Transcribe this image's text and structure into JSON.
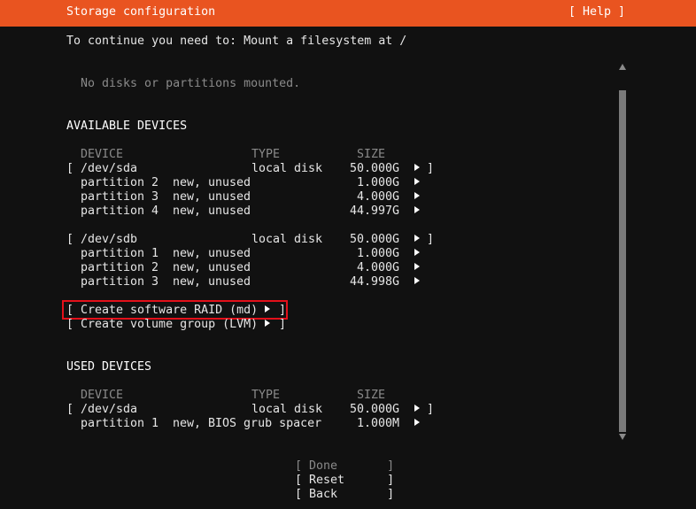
{
  "header": {
    "title": "Storage configuration",
    "help": "[ Help ]"
  },
  "instruction": "To continue you need to: Mount a filesystem at /",
  "mounted_empty": "No disks or partitions mounted.",
  "available": {
    "heading": "AVAILABLE DEVICES",
    "columns": {
      "device": "DEVICE",
      "type": "TYPE",
      "size": "SIZE"
    },
    "rows": [
      {
        "bracket_open": "[",
        "device": "/dev/sda",
        "type": "local disk",
        "size": "50.000G",
        "bracket_close": "]"
      },
      {
        "device": "partition 2",
        "type": "new, unused",
        "size": "1.000G"
      },
      {
        "device": "partition 3",
        "type": "new, unused",
        "size": "4.000G"
      },
      {
        "device": "partition 4",
        "type": "new, unused",
        "size": "44.997G"
      },
      {
        "bracket_open": "[",
        "device": "/dev/sdb",
        "type": "local disk",
        "size": "50.000G",
        "bracket_close": "]"
      },
      {
        "device": "partition 1",
        "type": "new, unused",
        "size": "1.000G"
      },
      {
        "device": "partition 2",
        "type": "new, unused",
        "size": "4.000G"
      },
      {
        "device": "partition 3",
        "type": "new, unused",
        "size": "44.998G"
      }
    ],
    "create_raid": {
      "open": "[",
      "label": "Create software RAID (md)",
      "close": "]"
    },
    "create_vg": {
      "open": "[",
      "label": "Create volume group (LVM)",
      "close": "]"
    }
  },
  "used": {
    "heading": "USED DEVICES",
    "columns": {
      "device": "DEVICE",
      "type": "TYPE",
      "size": "SIZE"
    },
    "rows": [
      {
        "bracket_open": "[",
        "device": "/dev/sda",
        "type": "local disk",
        "size": "50.000G",
        "bracket_close": "]"
      },
      {
        "device": "partition 1",
        "type": "new, BIOS grub spacer",
        "size": "1.000M"
      }
    ]
  },
  "buttons": {
    "done": "[ Done       ]",
    "reset": "[ Reset      ]",
    "back": "[ Back       ]"
  },
  "colors": {
    "header": "#E95420",
    "background": "#111111",
    "highlight_border": "#e3101a"
  },
  "icons": {
    "expand": "triangle-right-icon",
    "scroll_up": "scroll-up-arrow-icon",
    "scroll_down": "scroll-down-arrow-icon"
  }
}
